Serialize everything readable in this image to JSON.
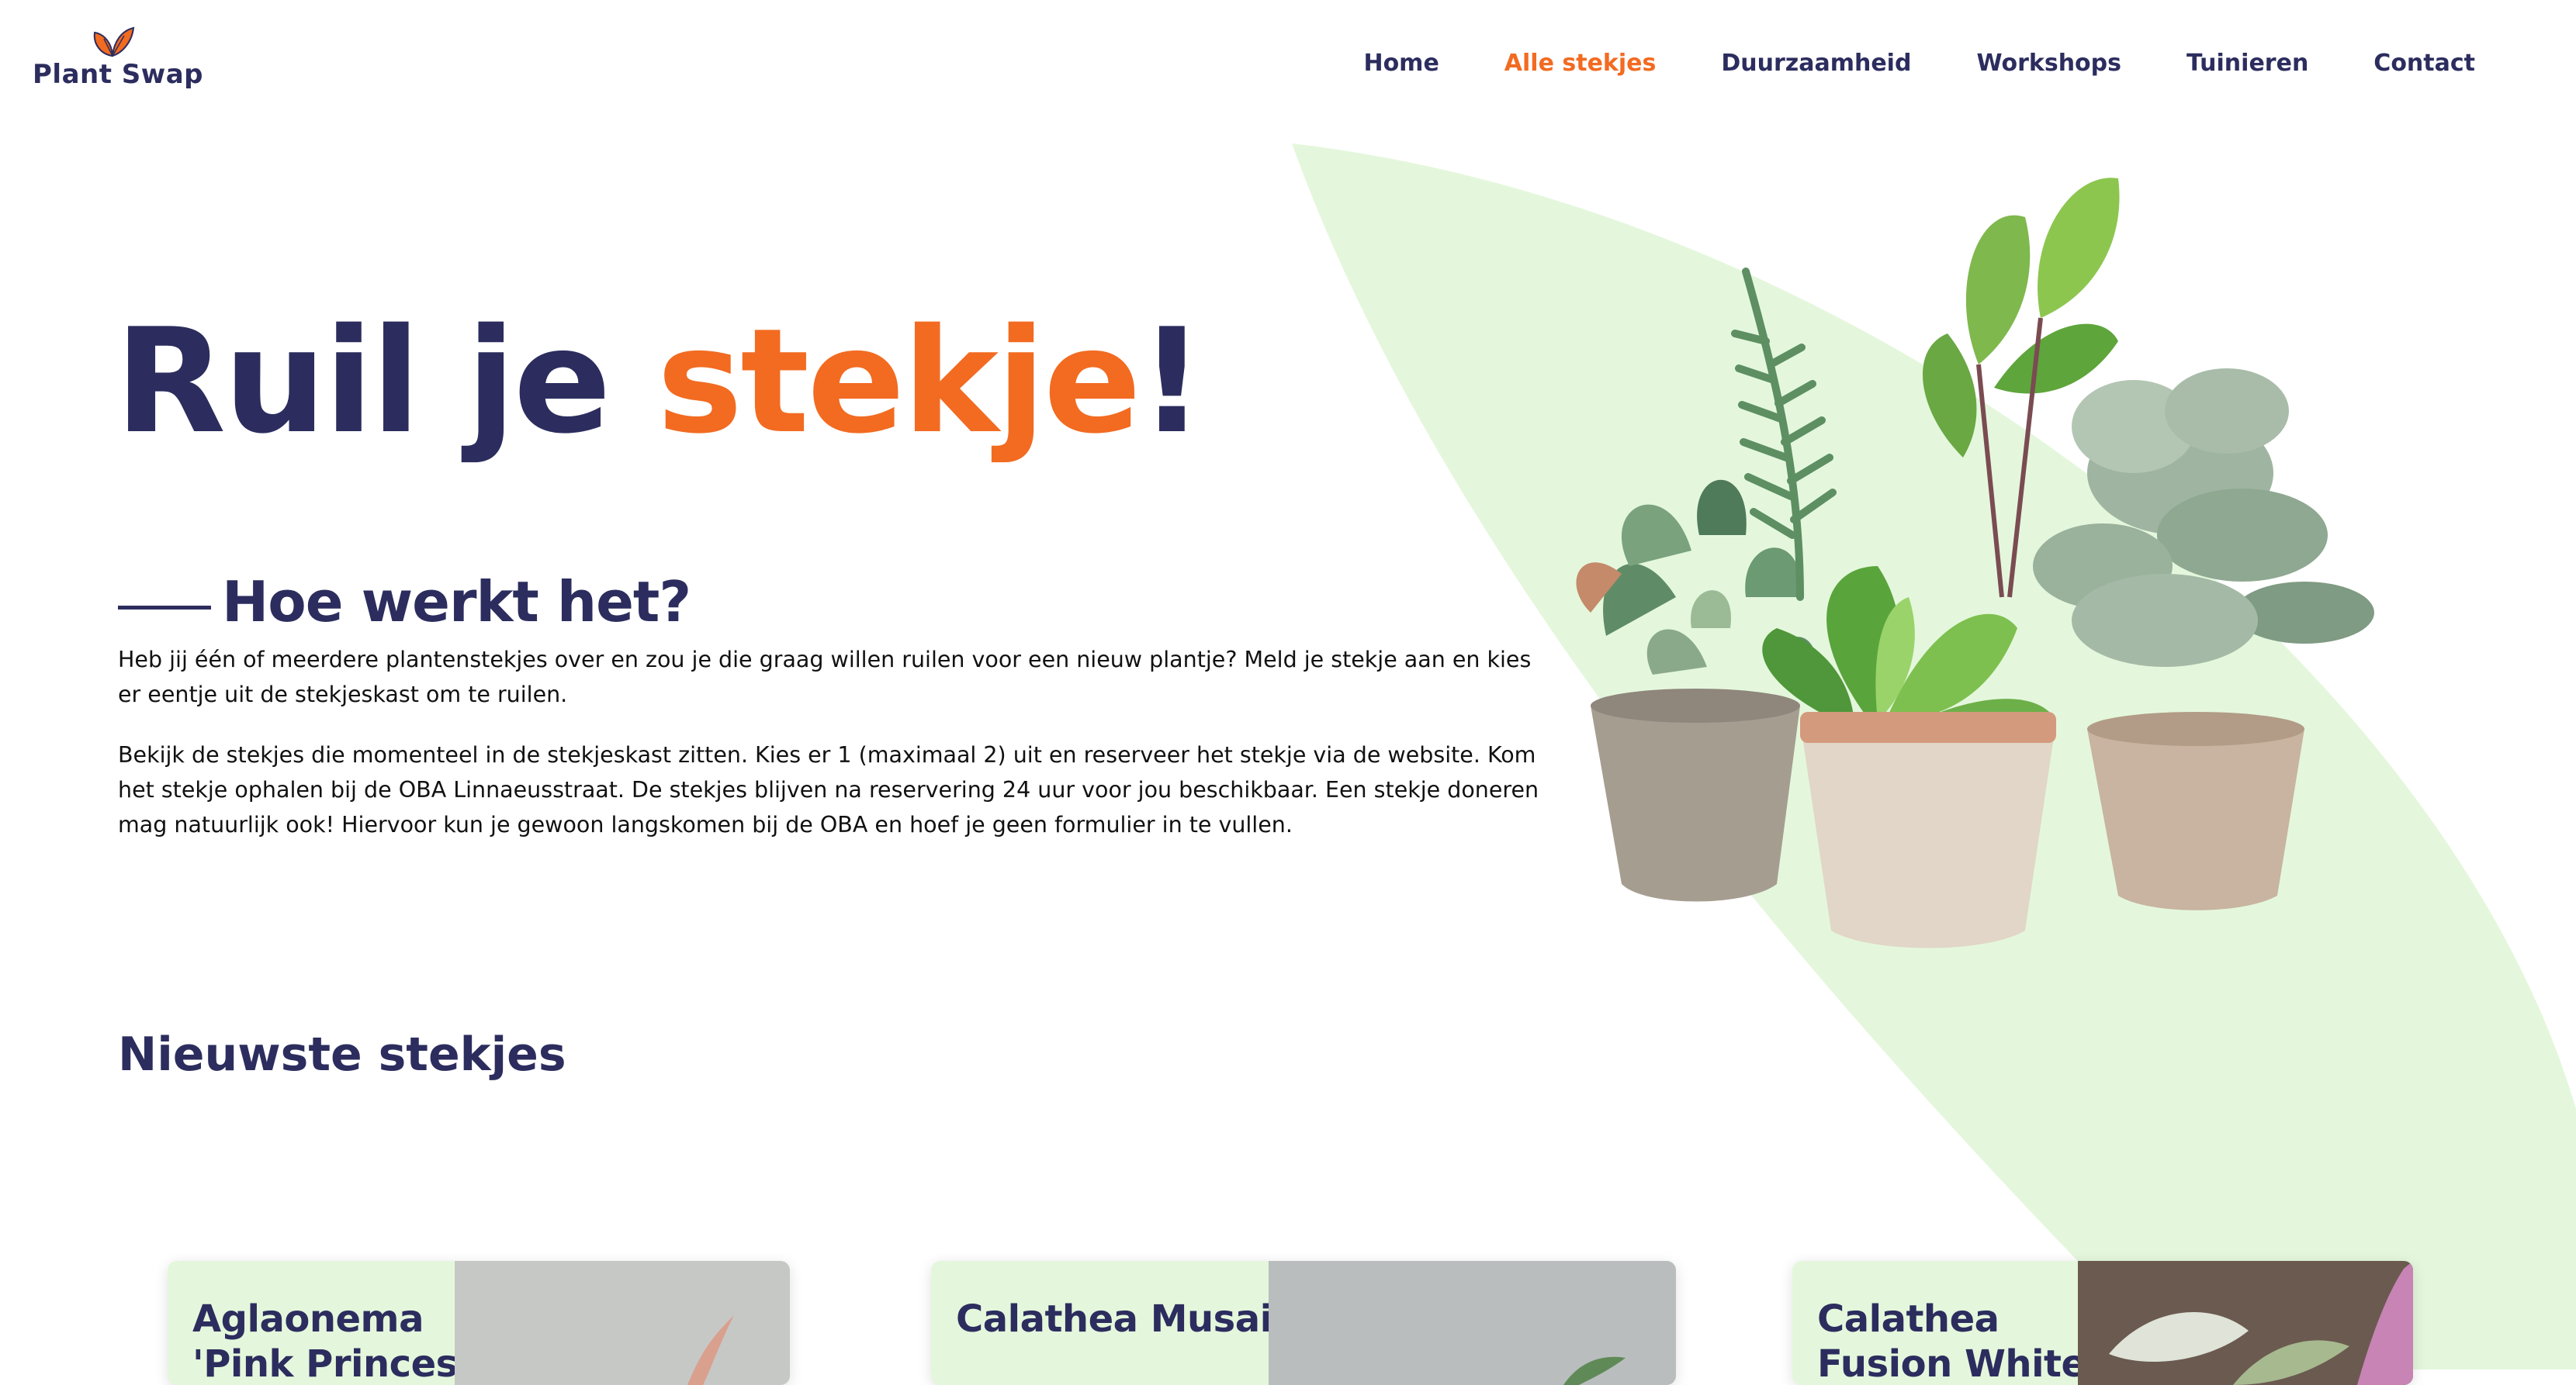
{
  "brand": {
    "logo_text": "Plant Swap",
    "primary_color": "#2c2d5e",
    "accent_color": "#f26b21",
    "leaf_color": "#e4f7dc"
  },
  "nav": {
    "items": [
      {
        "label": "Home",
        "active": false
      },
      {
        "label": "Alle stekjes",
        "active": true
      },
      {
        "label": "Duurzaamheid",
        "active": false
      },
      {
        "label": "Workshops",
        "active": false
      },
      {
        "label": "Tuinieren",
        "active": false
      },
      {
        "label": "Contact",
        "active": false
      }
    ]
  },
  "hero": {
    "title_part1": "Ruil je ",
    "title_accent": "stekje",
    "title_end": "!",
    "image_icon": "potted-plants-image"
  },
  "how": {
    "heading": "Hoe werkt het?",
    "paragraphs": [
      "Heb jij één of meerdere plantenstekjes over en zou je die graag willen ruilen voor een nieuw plantje? Meld je stekje aan en kies er eentje uit de stekjeskast om te ruilen.",
      "Bekijk de stekjes die momenteel in de stekjeskast zitten. Kies er 1 (maximaal 2) uit en reserveer het stekje via de website. Kom het stekje ophalen bij de OBA Linnaeusstraat. De stekjes blijven na reservering 24 uur voor jou beschikbaar. Een stekje doneren mag natuurlijk ook! Hiervoor kun je gewoon langskomen bij de OBA en hoef je geen formulier in te vullen."
    ]
  },
  "latest": {
    "heading": "Nieuwste stekjes",
    "cards": [
      {
        "title_line1": "Aglaonema",
        "title_line2": "'Pink Princess'"
      },
      {
        "title_line1": "Calathea Musaica",
        "title_line2": ""
      },
      {
        "title_line1": "Calathea",
        "title_line2": "Fusion White"
      }
    ]
  }
}
